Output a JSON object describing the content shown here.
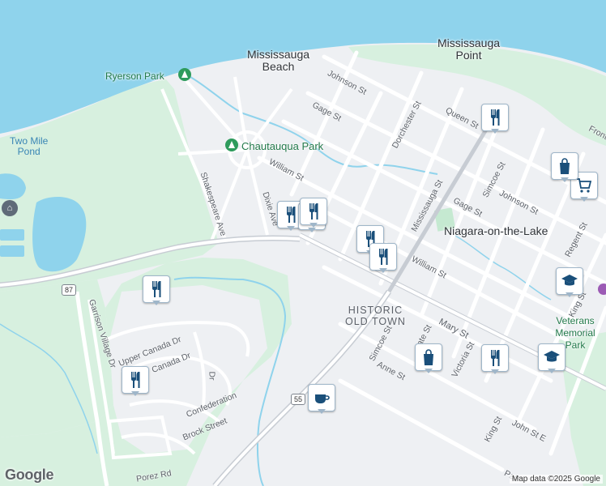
{
  "places": {
    "mississauga_beach": "Mississauga\nBeach",
    "mississauga_point": "Mississauga\nPoint",
    "niagara_on_the_lake": "Niagara-on-the-Lake",
    "historic_old_town": "HISTORIC\nOLD TOWN"
  },
  "parks": {
    "ryerson": "Ryerson Park",
    "chautauqua": "Chautauqua Park",
    "veterans": "Veterans\nMemorial Park"
  },
  "water": {
    "two_mile_pond": "Two Mile\nPond"
  },
  "streets": {
    "johnson_st_top": "Johnson St",
    "gage_st_top": "Gage St",
    "dorchester_st": "Dorchester St",
    "queen_st": "Queen St",
    "front": "Front",
    "william_st_top": "William St",
    "shakespeare_ave": "Shakespeare Ave",
    "dixie_ave": "Dixie Ave",
    "mississauga_st": "Mississauga St",
    "gage_st_right": "Gage St",
    "simcoe_st_top": "Simcoe St",
    "johnson_st_right": "Johnson St",
    "regent_st": "Regent St",
    "king_st_right": "King St",
    "william_st_right": "William St",
    "mary_st": "Mary St",
    "simcoe_st_bottom": "Simcoe St",
    "gate_st": "ate St",
    "victoria_st": "Victoria St",
    "anne_st": "Anne St",
    "garrison_village_dr": "Garrison Village Dr",
    "upper_canada_dr": "Upper Canada Dr",
    "canada_dr": "Canada Dr",
    "dr_vertical": "Dr",
    "confederation": "Confederation",
    "brock_street": "Brock Street",
    "king_st_bottom": "King St",
    "john_st_e": "John St E",
    "porez_rd": "Porez Rd",
    "paff": "Paff"
  },
  "shields": {
    "route_87": "87",
    "route_55": "55"
  },
  "footer": {
    "logo": "Google",
    "attribution": "Map data ©2025 Google"
  },
  "pins": [
    {
      "type": "restaurant",
      "icon": "fork-knife-icon"
    },
    {
      "type": "restaurant",
      "icon": "fork-knife-icon"
    },
    {
      "type": "restaurant",
      "icon": "fork-knife-icon"
    },
    {
      "type": "restaurant",
      "icon": "fork-knife-icon"
    },
    {
      "type": "restaurant",
      "icon": "fork-knife-icon"
    },
    {
      "type": "restaurant",
      "icon": "fork-knife-icon"
    },
    {
      "type": "restaurant",
      "icon": "fork-knife-icon"
    },
    {
      "type": "restaurant",
      "icon": "fork-knife-icon"
    },
    {
      "type": "restaurant",
      "icon": "fork-knife-icon"
    },
    {
      "type": "shopping",
      "icon": "shopping-bag-icon"
    },
    {
      "type": "cafe",
      "icon": "coffee-cup-icon"
    },
    {
      "type": "school",
      "icon": "graduation-cap-icon"
    },
    {
      "type": "school",
      "icon": "graduation-cap-icon"
    },
    {
      "type": "shopping",
      "icon": "shopping-cart-icon"
    },
    {
      "type": "shopping",
      "icon": "shopping-bag-icon"
    }
  ],
  "colors": {
    "water": "#8fd3ec",
    "park": "#d7f0df",
    "land": "#eef0f3",
    "road": "#ffffff",
    "highway": "#c7ccd3",
    "pin_icon": "#1a4f7a"
  }
}
